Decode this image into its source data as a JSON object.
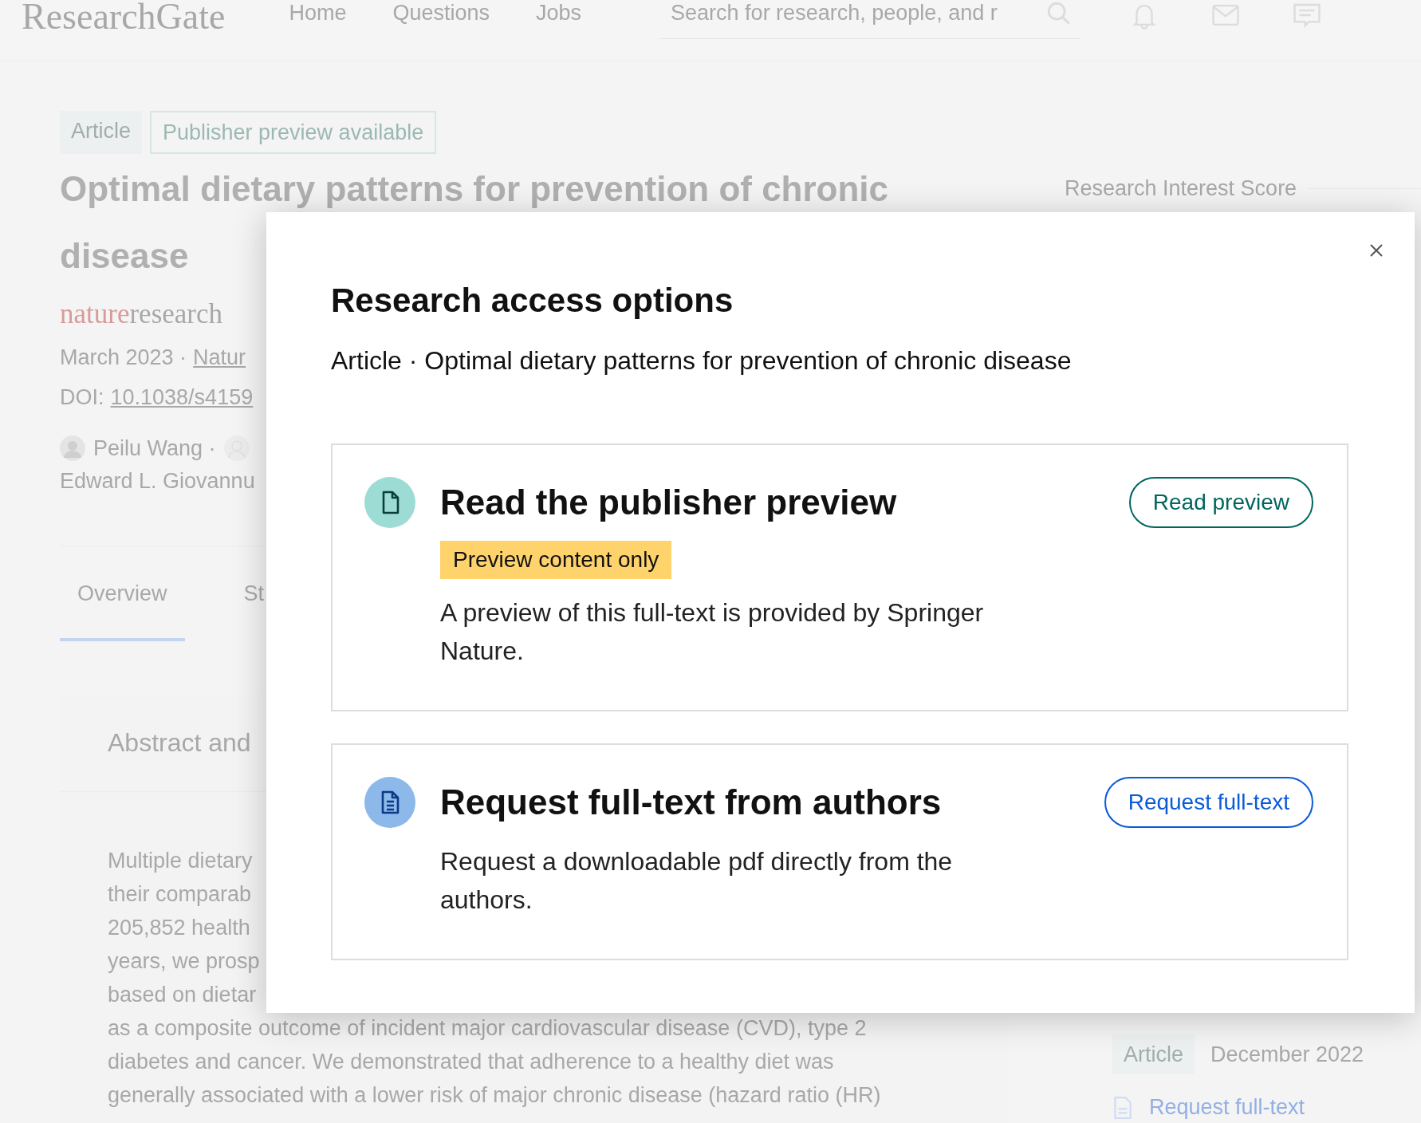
{
  "top_bar": {
    "logo": "ResearchGate",
    "nav": [
      "Home",
      "Questions",
      "Jobs"
    ],
    "search": {
      "placeholder": "Search for research, people, and r"
    }
  },
  "article": {
    "tags": [
      {
        "label": "Article",
        "kind": "filled"
      },
      {
        "label": "Publisher preview available",
        "kind": "outlined"
      }
    ],
    "title_lines": [
      "Optimal dietary patterns for prevention of chronic",
      "disease"
    ],
    "publisher_logo": {
      "part_1": "nature",
      "part_2": "research"
    },
    "date": "March 2023 ·",
    "journal_link": "Natur",
    "doi_label": "DOI:",
    "doi_link": "10.1038/s4159",
    "authors": {
      "line_1": "Peilu Wang ·",
      "line_2": "Edward L. Giovannu"
    },
    "tabs": [
      {
        "label": "Overview",
        "selected": true
      },
      {
        "label": "St",
        "selected": false
      }
    ],
    "abstract": {
      "heading": "Abstract and",
      "lines": [
        "Multiple dietary",
        "their comparab",
        "205,852 health",
        "years, we prosp",
        "based on dietar",
        "as a composite outcome of incident major cardiovascular disease (CVD), type 2",
        "diabetes and cancer. We demonstrated that adherence to a healthy diet was",
        "generally associated with a lower risk of major chronic disease (hazard ratio (HR)"
      ]
    }
  },
  "sidebar": {
    "score_heading": "Research Interest Score",
    "related": {
      "tag": "Article",
      "date": "December 2022",
      "link": "Request full-text"
    }
  },
  "modal": {
    "title": "Research access options",
    "subtitle": "Article · Optimal dietary patterns for prevention of chronic disease",
    "options": [
      {
        "kind": "preview",
        "heading": "Read the publisher preview",
        "badge": "Preview content only",
        "description": "A preview of this full-text is provided by Springer Nature.",
        "button": "Read preview"
      },
      {
        "kind": "request",
        "heading": "Request full-text from authors",
        "description": "Request a downloadable pdf directly from the authors.",
        "button": "Request full-text"
      }
    ]
  }
}
